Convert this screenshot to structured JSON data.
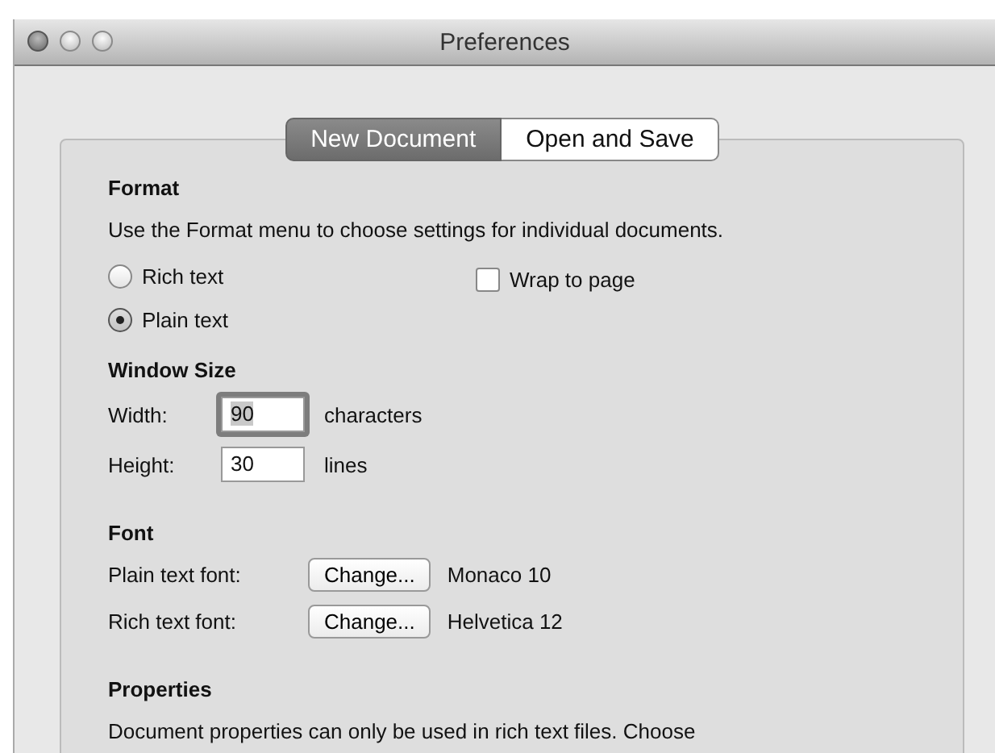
{
  "window": {
    "title": "Preferences"
  },
  "tabs": [
    {
      "label": "New Document",
      "selected": true
    },
    {
      "label": "Open and Save",
      "selected": false
    }
  ],
  "format": {
    "heading": "Format",
    "description": "Use the Format menu to choose settings for individual documents.",
    "radios": [
      {
        "label": "Rich text",
        "selected": false
      },
      {
        "label": "Plain text",
        "selected": true
      }
    ],
    "wrap_checkbox": {
      "label": "Wrap to page",
      "checked": false
    }
  },
  "window_size": {
    "heading": "Window Size",
    "fields": [
      {
        "label": "Width:",
        "value": "90",
        "unit": "characters",
        "focused": true
      },
      {
        "label": "Height:",
        "value": "30",
        "unit": "lines",
        "focused": false
      }
    ]
  },
  "font": {
    "heading": "Font",
    "rows": [
      {
        "label": "Plain text font:",
        "button": "Change...",
        "value": "Monaco 10"
      },
      {
        "label": "Rich text font:",
        "button": "Change...",
        "value": "Helvetica 12"
      }
    ]
  },
  "properties": {
    "heading": "Properties",
    "description": "Document properties can only be used in rich text files. Choose"
  }
}
